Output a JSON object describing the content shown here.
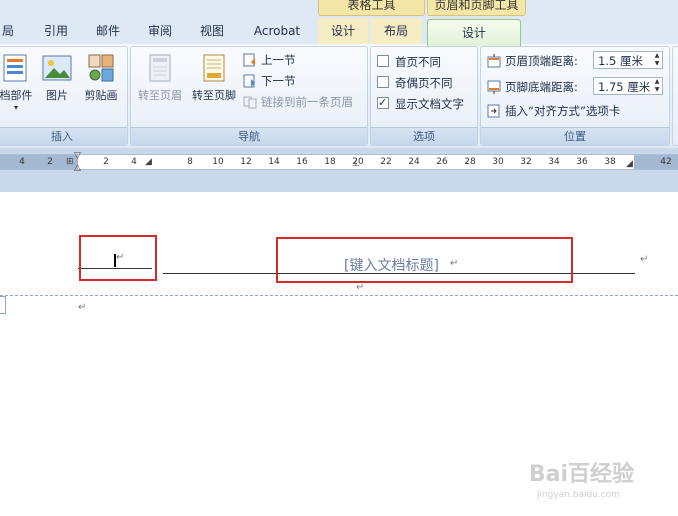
{
  "context_tabs": {
    "table_tools": "表格工具",
    "header_footer_tools": "页眉和页脚工具"
  },
  "tabs": [
    {
      "id": "layout-partial",
      "label": "局"
    },
    {
      "id": "references",
      "label": "引用"
    },
    {
      "id": "mailings",
      "label": "邮件"
    },
    {
      "id": "review",
      "label": "审阅"
    },
    {
      "id": "view",
      "label": "视图"
    },
    {
      "id": "acrobat",
      "label": "Acrobat"
    },
    {
      "id": "table-design",
      "label": "设计"
    },
    {
      "id": "table-layout",
      "label": "布局"
    },
    {
      "id": "hf-design",
      "label": "设计"
    }
  ],
  "insert_group": {
    "label": "插入",
    "quick_parts": "档部件",
    "picture": "图片",
    "clip_art": "剪贴画"
  },
  "nav_group": {
    "label": "导航",
    "goto_header": "转至页眉",
    "goto_footer": "转至页脚",
    "prev_section": "上一节",
    "next_section": "下一节",
    "link_previous": "链接到前一条页眉"
  },
  "options_group": {
    "label": "选项",
    "items": [
      {
        "label": "首页不同",
        "checked": false
      },
      {
        "label": "奇偶页不同",
        "checked": false
      },
      {
        "label": "显示文档文字",
        "checked": true
      }
    ]
  },
  "position_group": {
    "label": "位置",
    "header_top_label": "页眉顶端距离:",
    "header_top_value": "1.5 厘米",
    "footer_bottom_label": "页脚底端距离:",
    "footer_bottom_value": "1.75 厘米",
    "insert_align_tab": "插入“对齐方式”选项卡"
  },
  "ruler": {
    "labels": [
      "4",
      "2",
      "2",
      "4",
      "8",
      "10",
      "12",
      "14",
      "16",
      "18",
      "20",
      "22",
      "24",
      "26",
      "28",
      "30",
      "32",
      "34",
      "36",
      "38",
      "42"
    ]
  },
  "document": {
    "title_placeholder": "[键入文档标题]",
    "para_mark": "↵"
  },
  "watermark": {
    "text": "Bai百经验",
    "sub": "jingyan.baidu.com"
  }
}
